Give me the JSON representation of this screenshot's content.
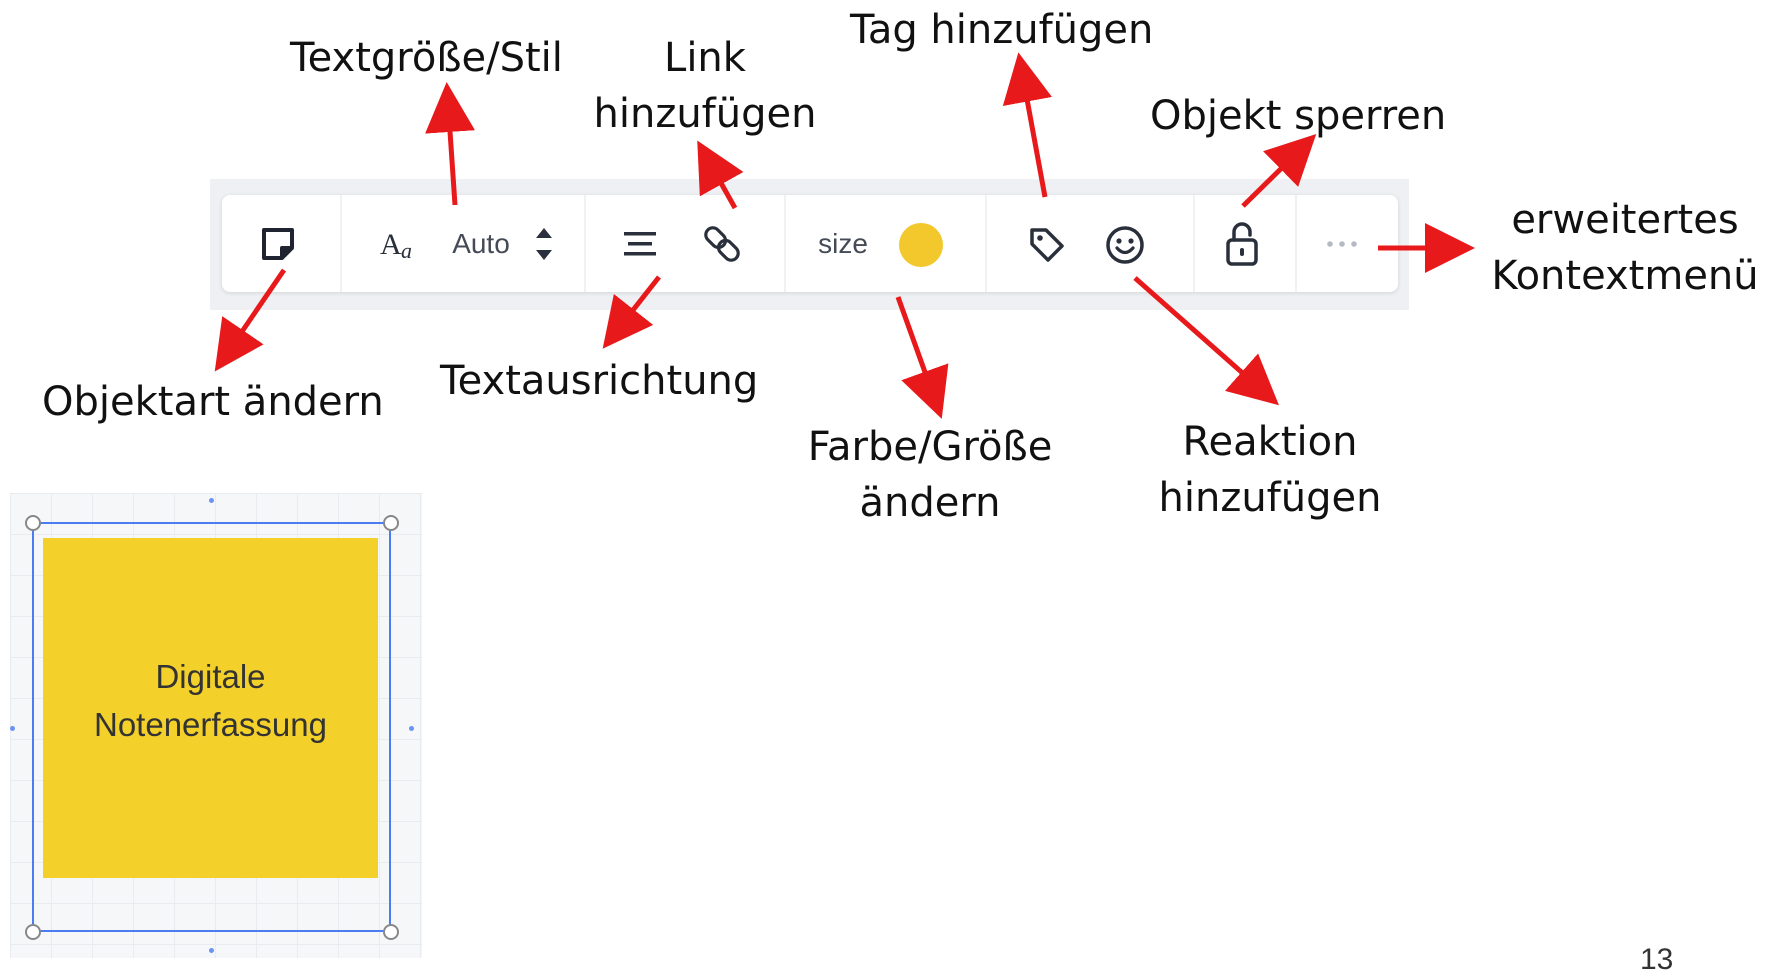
{
  "labels": {
    "textsize": "Textgröße/Stil",
    "link_line1": "Link",
    "link_line2": "hinzufügen",
    "tag": "Tag hinzufügen",
    "lock": "Objekt sperren",
    "context_line1": "erweitertes",
    "context_line2": "Kontextmenü",
    "objtype": "Objektart ändern",
    "align": "Textausrichtung",
    "color_line1": "Farbe/Größe",
    "color_line2": "ändern",
    "reaction_line1": "Reaktion",
    "reaction_line2": "hinzufügen"
  },
  "toolbar": {
    "font_size_value": "Auto",
    "size_label": "size",
    "color_swatch": "#f2c82c",
    "icons": [
      "sticky-note-icon",
      "text-style-icon",
      "stepper-icon",
      "align-center-icon",
      "link-icon",
      "tag-icon",
      "smiley-icon",
      "unlock-icon",
      "more-icon"
    ]
  },
  "sticky": {
    "line1": "Digitale",
    "line2": "Notenerfassung",
    "color": "#f4d02b"
  },
  "page_number": "13",
  "colors": {
    "arrow": "#e8191b",
    "selection": "#4b7cf1"
  }
}
